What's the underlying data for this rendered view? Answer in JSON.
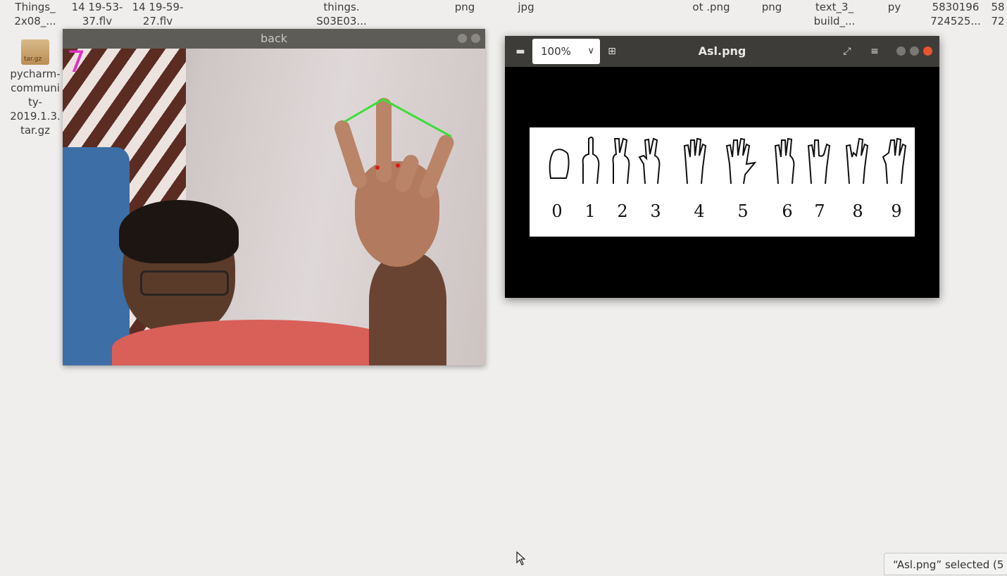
{
  "desktop": {
    "top_labels": [
      {
        "text": "Things_\n2x08_..."
      },
      {
        "text": "14 19-53-\n37.flv"
      },
      {
        "text": "14 19-59-\n27.flv"
      },
      {
        "text": "things.\nS03E03..."
      },
      {
        "text": "png"
      },
      {
        "text": "jpg"
      },
      {
        "text": "ot .png"
      },
      {
        "text": "png"
      },
      {
        "text": "text_3_\nbuild_..."
      },
      {
        "text": "py"
      },
      {
        "text": "5830196\n724525..."
      },
      {
        "text": "58\n72"
      }
    ],
    "archive_icon_text": "tar.gz",
    "archive_label": "pycharm-\ncommuni\nty-\n2019.1.3.\ntar.gz"
  },
  "back_window": {
    "title": "back",
    "overlay_digit": "7"
  },
  "asl_window": {
    "title": "Asl.png",
    "zoom": "100%",
    "digits": [
      "0",
      "1",
      "2",
      "3",
      "4",
      "5",
      "6",
      "7",
      "8",
      "9"
    ]
  },
  "status_bar": {
    "text": "“Asl.png” selected (5"
  },
  "colors": {
    "overlay_green": "#3fdc3a",
    "overlay_red": "#d81b1b",
    "overlay_magenta": "#e030c8"
  }
}
